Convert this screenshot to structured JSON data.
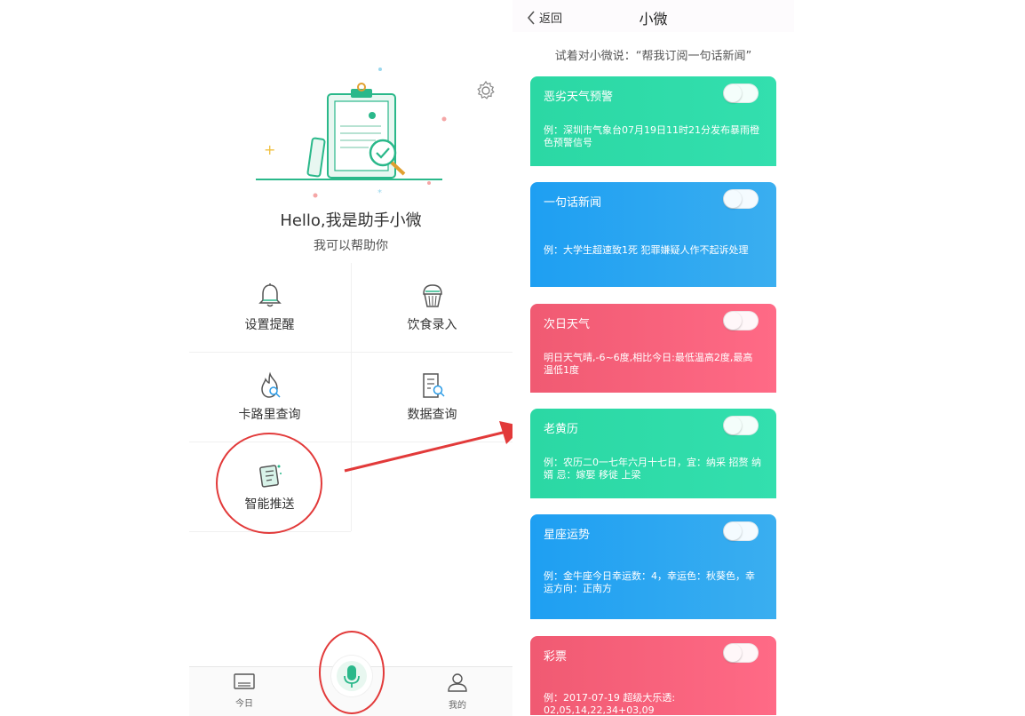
{
  "left_app": {
    "greeting_title": "Hello,我是助手小微",
    "greeting_sub": "我可以帮助你",
    "features": [
      {
        "label": "设置提醒",
        "icon": "bell-icon"
      },
      {
        "label": "饮食录入",
        "icon": "cupcake-icon"
      },
      {
        "label": "卡路里查询",
        "icon": "flame-search-icon"
      },
      {
        "label": "数据查询",
        "icon": "document-search-icon"
      },
      {
        "label": "智能推送",
        "icon": "push-document-icon"
      }
    ],
    "tabs": [
      {
        "label": "今日",
        "icon": "inbox-icon"
      },
      {
        "label": "我的",
        "icon": "person-icon"
      }
    ],
    "mic_icon": "microphone-icon",
    "settings_icon": "gear-icon"
  },
  "right_app": {
    "back_label": "返回",
    "title": "小微",
    "hint": "试着对小微说：“帮我订阅一句话新闻”",
    "cards": [
      {
        "title": "恶劣天气预警",
        "desc": "例：深圳市气象台07月19日11时21分发布暴雨橙色预警信号",
        "color": "#2ed9a8"
      },
      {
        "title": "一句话新闻",
        "desc": "例：大学生超速致1死 犯罪嫌疑人作不起诉处理",
        "color": "#2aa6f2"
      },
      {
        "title": "次日天气",
        "desc": "明日天气晴,-6~6度,相比今日:最低温高2度,最高温低1度",
        "color": "#f7627b"
      },
      {
        "title": "老黄历",
        "desc": "例：农历二0一七年六月十七日，宜：纳采 招赘 纳婿 忌：嫁娶 移徙 上梁",
        "color": "#2ed9a8"
      },
      {
        "title": "星座运势",
        "desc": "例：金牛座今日幸运数：4，幸运色：秋葵色，幸运方向：正南方",
        "color": "#2aa6f2"
      },
      {
        "title": "彩票",
        "desc": "例：2017-07-19 超级大乐透: 02,05,14,22,34+03,09",
        "color": "#f7627b"
      }
    ]
  },
  "colors": {
    "accent_green": "#2ab88a",
    "annotation_red": "#e23a3a"
  }
}
